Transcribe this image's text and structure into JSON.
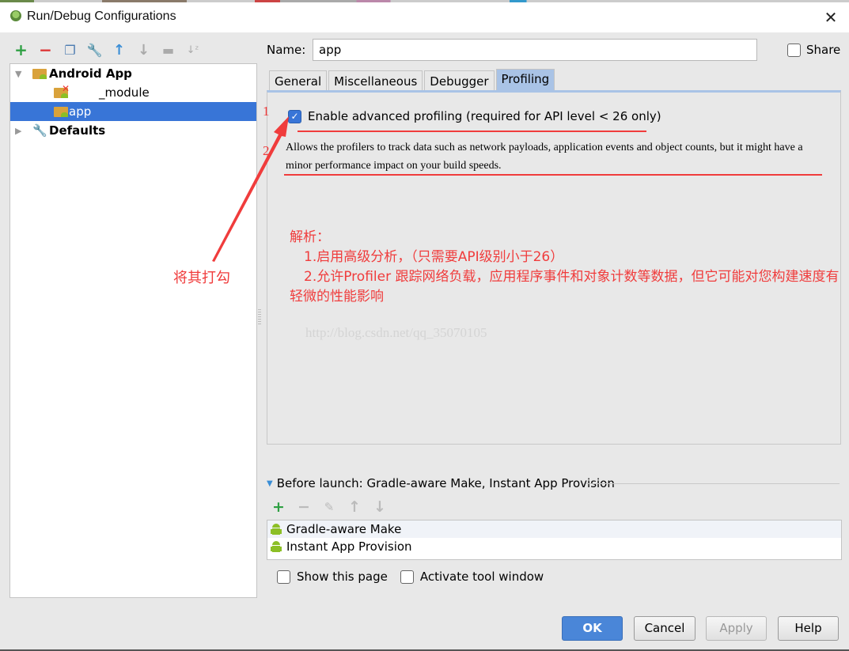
{
  "window": {
    "title": "Run/Debug Configurations",
    "close_icon": "close-icon"
  },
  "toolbar": {
    "icons": [
      "add-icon",
      "remove-icon",
      "copy-icon",
      "edit-defaults-icon",
      "move-up-icon",
      "move-down-icon",
      "folder-icon",
      "sort-icon"
    ]
  },
  "tree": {
    "items": [
      {
        "label": "Android App",
        "level": 0,
        "expanded": true,
        "bold": true
      },
      {
        "label": "_module",
        "level": 1,
        "error": true
      },
      {
        "label": "app",
        "level": 1,
        "selected": true
      },
      {
        "label": "Defaults",
        "level": 0,
        "expanded": false,
        "bold": true
      }
    ]
  },
  "form": {
    "name_label": "Name:",
    "name_value": "app",
    "share_label": "Share",
    "share_checked": false
  },
  "tabs": [
    {
      "label": "General",
      "active": false
    },
    {
      "label": "Miscellaneous",
      "active": false
    },
    {
      "label": "Debugger",
      "active": false
    },
    {
      "label": "Profiling",
      "active": true
    }
  ],
  "profiling": {
    "enable_label": "Enable advanced profiling (required for API level < 26 only)",
    "enable_checked": true,
    "description": "Allows the profilers to track data such as network payloads, application events and object counts, but it might have a minor performance impact on your build speeds."
  },
  "annotations": {
    "marker1": "1",
    "marker2": "2",
    "note": "将其打勾",
    "analysis_title": "解析：",
    "analysis_line1": "1.启用高级分析，（只需要API级别小于26）",
    "analysis_line2": "2.允许Profiler 跟踪网络负载，应用程序事件和对象计数等数据，但它可能对您构建速度有轻微的性能影响",
    "watermark": "http://blog.csdn.net/qq_35070105",
    "color": "#f03c3c"
  },
  "before_launch": {
    "header": "Before launch: Gradle-aware Make, Instant App Provision",
    "toolbar_icons": [
      "add-icon",
      "remove-icon",
      "edit-icon",
      "move-up-icon",
      "move-down-icon"
    ],
    "items": [
      "Gradle-aware Make",
      "Instant App Provision"
    ]
  },
  "options": {
    "show_this_page": "Show this page",
    "show_this_page_checked": false,
    "activate_tool_window": "Activate tool window",
    "activate_tool_window_checked": false
  },
  "buttons": {
    "ok": "OK",
    "cancel": "Cancel",
    "apply": "Apply",
    "help": "Help"
  }
}
